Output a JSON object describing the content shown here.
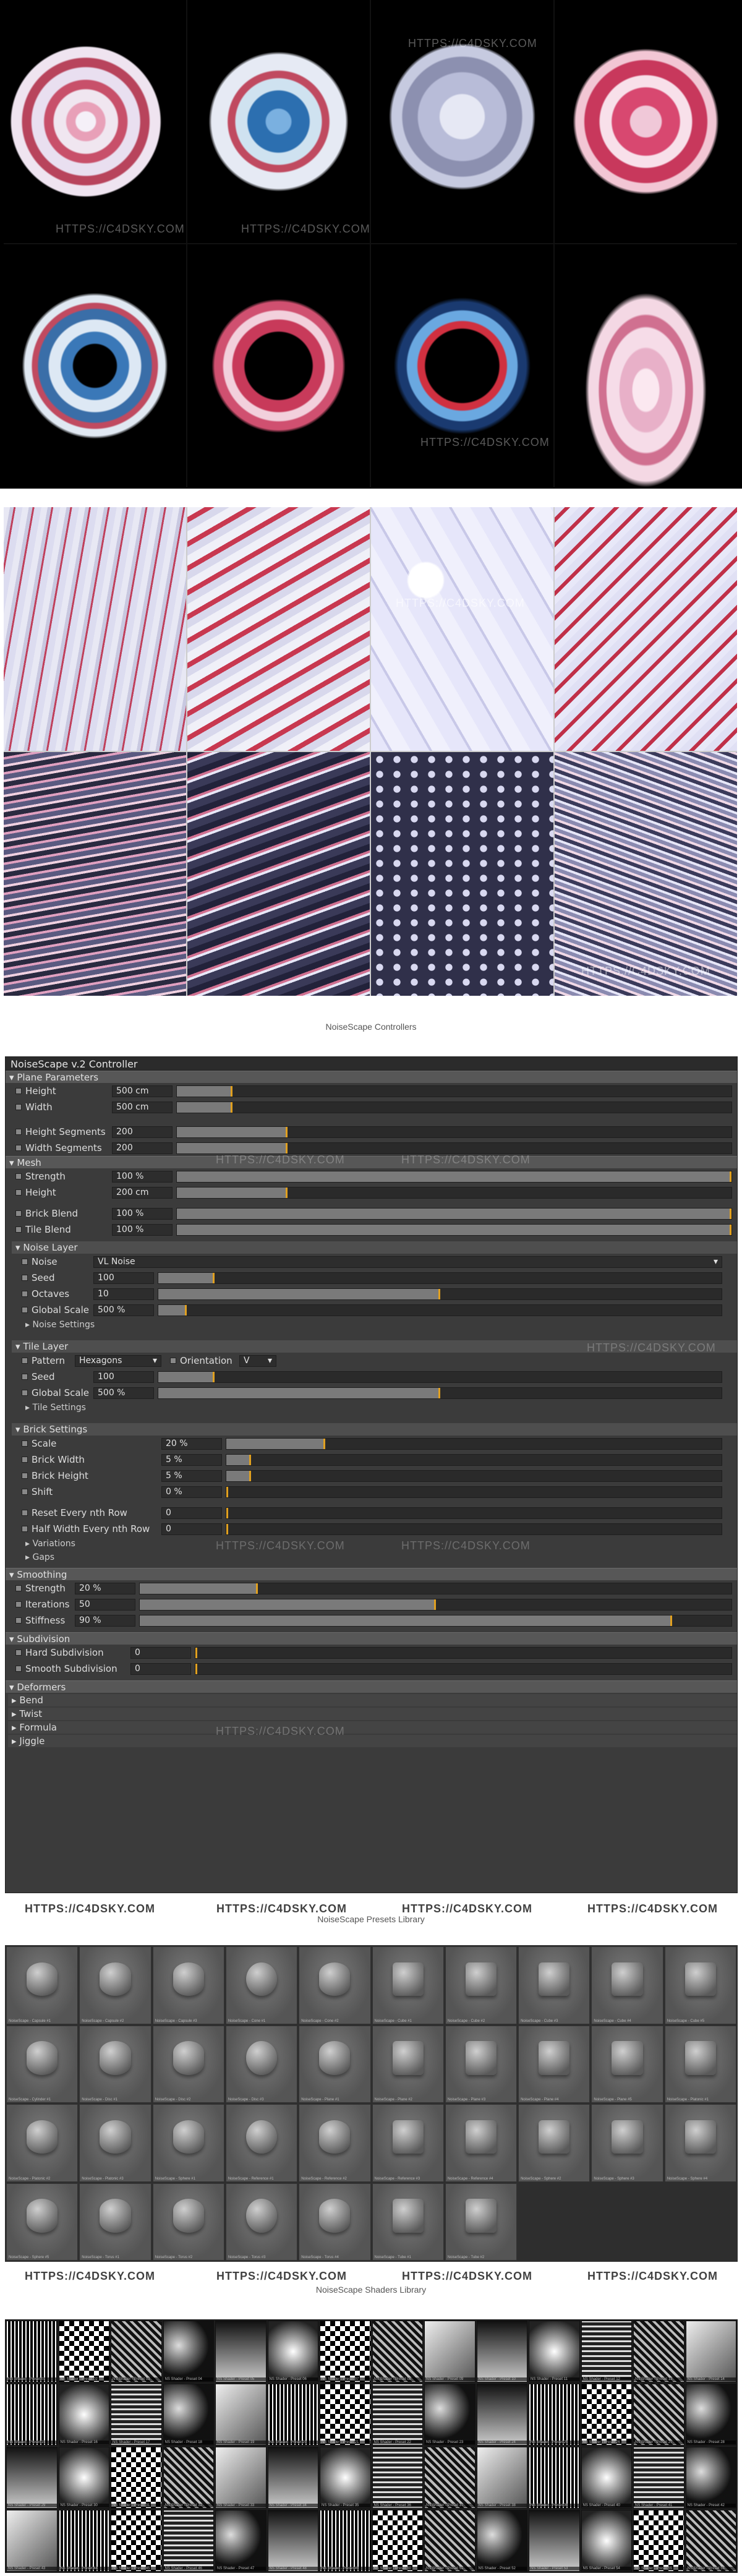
{
  "watermark": "HTTPS://C4DSKY.COM",
  "renders": {
    "tiles": 8
  },
  "surfaces": {
    "tiles": 8
  },
  "controller_caption": "NoiseScape Controllers",
  "controller": {
    "title": "NoiseScape v.2 Controller",
    "plane": {
      "header": "Plane Parameters",
      "height": {
        "label": "Height",
        "value": "500 cm",
        "level": 0.1
      },
      "width": {
        "label": "Width",
        "value": "500 cm",
        "level": 0.1
      },
      "hseg": {
        "label": "Height Segments",
        "value": "200",
        "level": 0.2
      },
      "wseg": {
        "label": "Width Segments",
        "value": "200",
        "level": 0.2
      }
    },
    "mesh": {
      "header": "Mesh",
      "strength": {
        "label": "Strength",
        "value": "100 %",
        "level": 1.0
      },
      "height": {
        "label": "Height",
        "value": "200 cm",
        "level": 0.2
      },
      "brick": {
        "label": "Brick Blend",
        "value": "100 %",
        "level": 1.0
      },
      "tile": {
        "label": "Tile Blend",
        "value": "100 %",
        "level": 1.0
      }
    },
    "noise": {
      "header": "Noise Layer",
      "noise": {
        "label": "Noise",
        "value": "VL Noise"
      },
      "seed": {
        "label": "Seed",
        "value": "100",
        "level": 0.1
      },
      "octaves": {
        "label": "Octaves",
        "value": "10",
        "level": 0.5
      },
      "gscale": {
        "label": "Global Scale",
        "value": "500 %",
        "level": 0.05
      },
      "settings": "Noise Settings"
    },
    "tile": {
      "header": "Tile Layer",
      "pattern": {
        "label": "Pattern",
        "value": "Hexagons"
      },
      "orientation": {
        "label": "Orientation",
        "value": "V"
      },
      "seed": {
        "label": "Seed",
        "value": "100",
        "level": 0.1
      },
      "gscale": {
        "label": "Global Scale",
        "value": "500 %",
        "level": 0.5
      },
      "settings": "Tile Settings"
    },
    "brick": {
      "header": "Brick Settings",
      "scale": {
        "label": "Scale",
        "value": "20 %",
        "level": 0.2
      },
      "bwidth": {
        "label": "Brick Width",
        "value": "5 %",
        "level": 0.05
      },
      "bheight": {
        "label": "Brick Height",
        "value": "5 %",
        "level": 0.05
      },
      "shift": {
        "label": "Shift",
        "value": "0 %",
        "level": 0.0
      },
      "reset": {
        "label": "Reset Every nth Row",
        "value": "0",
        "level": 0.0
      },
      "half": {
        "label": "Half Width Every nth Row",
        "value": "0",
        "level": 0.0
      },
      "variations": "Variations",
      "gaps": "Gaps"
    },
    "smoothing": {
      "header": "Smoothing",
      "strength": {
        "label": "Strength",
        "value": "20 %",
        "level": 0.2
      },
      "iterations": {
        "label": "Iterations",
        "value": "50",
        "level": 0.5
      },
      "stiffness": {
        "label": "Stiffness",
        "value": "90 %",
        "level": 0.9
      }
    },
    "subdivision": {
      "header": "Subdivision",
      "hard": {
        "label": "Hard Subdivision",
        "value": "0",
        "level": 0.0
      },
      "smooth": {
        "label": "Smooth Subdivision",
        "value": "0",
        "level": 0.0
      }
    },
    "deformers": {
      "header": "Deformers",
      "items": [
        "Bend",
        "Twist",
        "Formula",
        "Jiggle"
      ]
    }
  },
  "presets_caption": "NoiseScape Presets Library",
  "presets": [
    "NoiseScape - Capsule #1",
    "NoiseScape - Capsule #2",
    "NoiseScape - Capsule #3",
    "NoiseScape - Cone #1",
    "NoiseScape - Cone #2",
    "NoiseScape - Cube #1",
    "NoiseScape - Cube #2",
    "NoiseScape - Cube #3",
    "NoiseScape - Cube #4",
    "NoiseScape - Cube #5",
    "NoiseScape - Cylinder #1",
    "NoiseScape - Disc #1",
    "NoiseScape - Disc #2",
    "NoiseScape - Disc #3",
    "NoiseScape - Plane #1",
    "NoiseScape - Plane #2",
    "NoiseScape - Plane #3",
    "NoiseScape - Plane #4",
    "NoiseScape - Plane #5",
    "NoiseScape - Platonic #1",
    "NoiseScape - Platonic #2",
    "NoiseScape - Platonic #3",
    "NoiseScape - Sphere #1",
    "NoiseScape - Reference #1",
    "NoiseScape - Reference #2",
    "NoiseScape - Reference #3",
    "NoiseScape - Reference #4",
    "NoiseScape - Sphere #2",
    "NoiseScape - Sphere #3",
    "NoiseScape - Sphere #4",
    "NoiseScape - Sphere #5",
    "NoiseScape - Torus #1",
    "NoiseScape - Torus #2",
    "NoiseScape - Torus #3",
    "NoiseScape - Torus #4",
    "NoiseScape - Tube #1",
    "NoiseScape - Tube #2"
  ],
  "shaders_caption": "NoiseScape Shaders Library",
  "shaders": [
    "NS Shader - Preset 01",
    "NS Shader - Preset 02",
    "NS Shader - Preset 03",
    "NS Shader - Preset 04",
    "NS Shader - Preset 05",
    "NS Shader - Preset 06",
    "NS Shader - Preset 07",
    "NS Shader - Preset 08",
    "NS Shader - Preset 09",
    "NS Shader - Preset 10",
    "NS Shader - Preset 11",
    "NS Shader - Preset 12",
    "NS Shader - Preset 13",
    "NS Shader - Preset 14",
    "NS Shader - Preset 15",
    "NS Shader - Preset 16",
    "NS Shader - Preset 17",
    "NS Shader - Preset 18",
    "NS Shader - Preset 19",
    "NS Shader - Preset 20",
    "NS Shader - Preset 21",
    "NS Shader - Preset 22",
    "NS Shader - Preset 23",
    "NS Shader - Preset 24",
    "NS Shader - Preset 25",
    "NS Shader - Preset 26",
    "NS Shader - Preset 27",
    "NS Shader - Preset 28",
    "NS Shader - Preset 29",
    "NS Shader - Preset 30",
    "NS Shader - Preset 31",
    "NS Shader - Preset 32",
    "NS Shader - Preset 33",
    "NS Shader - Preset 34",
    "NS Shader - Preset 35",
    "NS Shader - Preset 36",
    "NS Shader - Preset 37",
    "NS Shader - Preset 38",
    "NS Shader - Preset 39",
    "NS Shader - Preset 40",
    "NS Shader - Preset 41",
    "NS Shader - Preset 42",
    "NS Shader - Preset 43",
    "NS Shader - Preset 44",
    "NS Shader - Preset 45",
    "NS Shader - Preset 46",
    "NS Shader - Preset 47",
    "NS Shader - Preset 48",
    "NS Shader - Preset 49",
    "NS Shader - Preset 50",
    "NS Shader - Preset 51",
    "NS Shader - Preset 52",
    "NS Shader - Preset 53",
    "NS Shader - Preset 54",
    "NS Shader - Preset 55",
    "NS Shader - Preset 56"
  ]
}
